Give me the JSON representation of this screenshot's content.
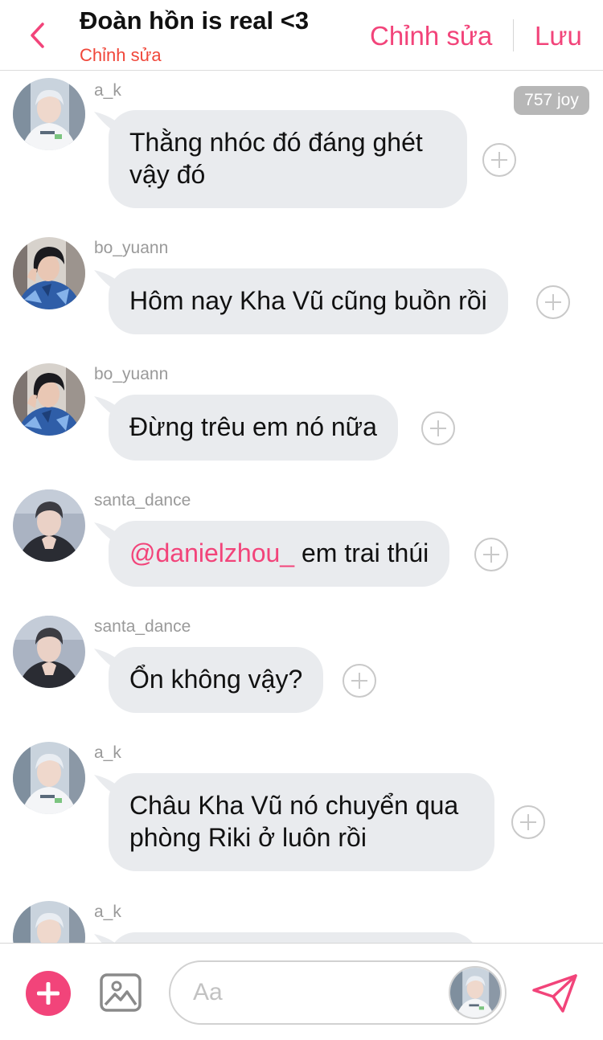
{
  "header": {
    "title": "Đoàn hồn is real <3",
    "subtitle": "Chỉnh sửa",
    "edit_label": "Chỉnh sửa",
    "save_label": "Lưu"
  },
  "joy_badge": "757 joy",
  "messages": [
    {
      "username": "a_k",
      "text_line1": "Thằng nhóc đó đáng ghét",
      "text_line2": "vậy đó"
    },
    {
      "username": "bo_yuann",
      "text": "Hôm nay Kha Vũ cũng buồn rồi"
    },
    {
      "username": "bo_yuann",
      "text": "Đừng trêu em nó nữa"
    },
    {
      "username": "santa_dance",
      "mention": "@danielzhou_",
      "text": " em trai thúi"
    },
    {
      "username": "santa_dance",
      "text": "Ổn không vậy?"
    },
    {
      "username": "a_k",
      "text_line1": "Châu Kha Vũ nó chuyển qua",
      "text_line2": "phòng Riki ở luôn rồi"
    },
    {
      "username": "a_k"
    }
  ],
  "input": {
    "placeholder": "Aa"
  },
  "colors": {
    "accent": "#f2447a",
    "subtitle_red": "#f0473a",
    "bubble": "#e9ebee",
    "username_gray": "#9a9a9a"
  },
  "icons": {
    "back": "chevron-left-icon",
    "add": "plus-icon",
    "image": "image-icon",
    "send": "paper-plane-icon",
    "react": "plus-circle-icon"
  }
}
